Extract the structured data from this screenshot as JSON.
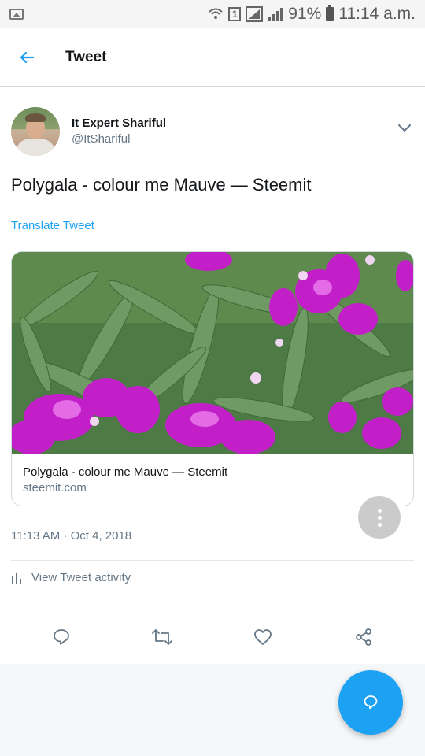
{
  "status_bar": {
    "sim_label": "1",
    "battery": "91%",
    "time": "11:14 a.m."
  },
  "header": {
    "title": "Tweet"
  },
  "tweet": {
    "author_name": "It Expert Shariful",
    "author_handle": "@ItShariful",
    "text": "Polygala - colour me Mauve — Steemit",
    "translate_label": "Translate Tweet",
    "card": {
      "title": "Polygala - colour me Mauve — Steemit",
      "domain": "steemit.com"
    },
    "timestamp": "11:13 AM · Oct 4, 2018",
    "activity_label": "View Tweet activity"
  },
  "colors": {
    "accent": "#1da1f2",
    "secondary_text": "#657786",
    "primary_text": "#14171a"
  },
  "icons": {
    "back": "arrow-left-icon",
    "chevron": "chevron-down-icon",
    "activity": "bar-chart-icon",
    "reply": "reply-icon",
    "retweet": "retweet-icon",
    "like": "heart-icon",
    "share": "share-icon",
    "more": "more-vertical-icon",
    "compose": "compose-reply-icon"
  }
}
